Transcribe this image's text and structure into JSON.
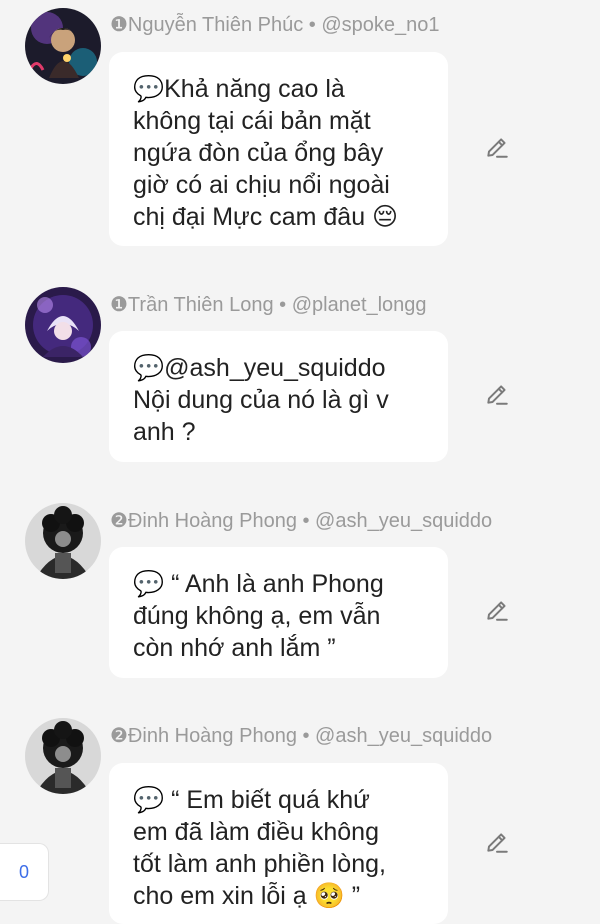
{
  "comments": [
    {
      "meta": "❶Nguyễn Thiên Phúc • @spoke_no1",
      "lines": [
        "💬Khả năng cao là",
        "không tại cái bản mặt",
        "ngứa đòn của ổng bây",
        "giờ có ai chịu nổi ngoài",
        "chị đại Mực cam đâu 😔"
      ]
    },
    {
      "meta": "❶Trần Thiên Long • @planet_longg",
      "lines": [
        "💬@ash_yeu_squiddo",
        "Nội dung của nó là gì v",
        "anh ?"
      ]
    },
    {
      "meta": "❷Đinh Hoàng Phong • @ash_yeu_squiddo",
      "lines": [
        "💬 “ Anh là anh Phong",
        "đúng không ạ, em vẫn",
        "còn nhớ anh lắm ”"
      ]
    },
    {
      "meta": "❷Đinh Hoàng Phong • @ash_yeu_squiddo",
      "lines": [
        "💬 “ Em biết quá khứ",
        "em đã làm điều không",
        "tốt làm anh phiền lòng,",
        "cho em xin lỗi ạ 🥺 ”"
      ]
    }
  ],
  "reply_count": "0",
  "icons": {
    "edit": "pencil-icon"
  },
  "colors": {
    "background": "#f4f4f4",
    "bubble": "#ffffff",
    "meta_text": "#9a9a9a",
    "badge_text": "#3d6ee8"
  }
}
